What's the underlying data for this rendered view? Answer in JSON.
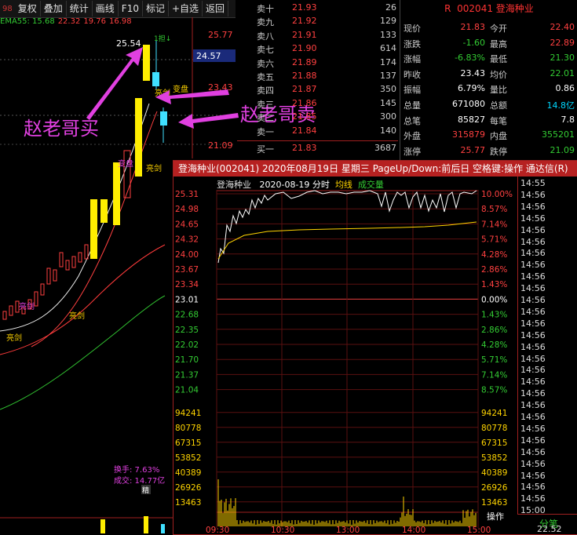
{
  "toolbar": {
    "left_fragment": "98",
    "buttons": [
      "复权",
      "叠加",
      "统计",
      "画线",
      "F10",
      "标记",
      "+自选",
      "返回"
    ]
  },
  "indicator_line": {
    "label": "EMA55: 15.68",
    "values": [
      "22.32",
      "19.76",
      "16.98"
    ]
  },
  "kline": {
    "high_label": "25.54",
    "signal_label": "1担↓",
    "price_axis": [
      "25.77",
      "24.57",
      "23.43",
      "21.09"
    ],
    "markers": [
      "亮剑",
      "变盘",
      "亮剑",
      "变盘",
      "亮剑",
      "亮剑",
      "亮剑"
    ],
    "turnover": "换手: 7.63%",
    "volume_amount": "成交: 14.77亿",
    "bottom_tag": "精"
  },
  "annotations": {
    "buy": "赵老哥买",
    "sell": "赵老哥卖"
  },
  "orderbook": {
    "rows": [
      {
        "label": "卖十",
        "price": "21.93",
        "vol": "26"
      },
      {
        "label": "卖九",
        "price": "21.92",
        "vol": "129"
      },
      {
        "label": "卖八",
        "price": "21.91",
        "vol": "133"
      },
      {
        "label": "卖七",
        "price": "21.90",
        "vol": "614"
      },
      {
        "label": "卖六",
        "price": "21.89",
        "vol": "174"
      },
      {
        "label": "卖五",
        "price": "21.88",
        "vol": "137"
      },
      {
        "label": "卖四",
        "price": "21.87",
        "vol": "350"
      },
      {
        "label": "卖三",
        "price": "21.86",
        "vol": "145"
      },
      {
        "label": "卖二",
        "price": "21.85",
        "vol": "300"
      },
      {
        "label": "卖一",
        "price": "21.84",
        "vol": "140"
      },
      {
        "label": "买一",
        "price": "21.83",
        "vol": "3687"
      }
    ]
  },
  "quote": {
    "title_prefix": "R",
    "code": "002041",
    "name": "登海种业",
    "rows": [
      {
        "l": "现价",
        "lv": "21.83",
        "lc": "red",
        "r": "今开",
        "rv": "22.40",
        "rc": "red"
      },
      {
        "l": "涨跌",
        "lv": "-1.60",
        "lc": "green",
        "r": "最高",
        "rv": "22.89",
        "rc": "red"
      },
      {
        "l": "涨幅",
        "lv": "-6.83%",
        "lc": "green",
        "r": "最低",
        "rv": "21.30",
        "rc": "green"
      },
      {
        "l": "昨收",
        "lv": "23.43",
        "lc": "white",
        "r": "均价",
        "rv": "22.01",
        "rc": "green"
      },
      {
        "l": "振幅",
        "lv": "6.79%",
        "lc": "white",
        "r": "量比",
        "rv": "0.86",
        "rc": "white"
      },
      {
        "l": "总量",
        "lv": "671080",
        "lc": "white",
        "r": "总额",
        "rv": "14.8亿",
        "rc": "cyan"
      },
      {
        "l": "总笔",
        "lv": "85827",
        "lc": "white",
        "r": "每笔",
        "rv": "7.8",
        "rc": "white"
      },
      {
        "l": "外盘",
        "lv": "315879",
        "lc": "red",
        "r": "内盘",
        "rv": "355201",
        "rc": "green"
      },
      {
        "l": "涨停",
        "lv": "25.77",
        "lc": "red",
        "r": "跌停",
        "rv": "21.09",
        "rc": "green"
      }
    ]
  },
  "popup": {
    "title": "登海种业(002041) 2020年08月19日 星期三 PageUp/Down:前后日 空格键:操作 通达信(R)",
    "chart_header": {
      "name": "登海种业",
      "date": "2020-08-19 分时",
      "avg_label": "均线",
      "vol_label": "成交量"
    },
    "left_axis": [
      "25.31",
      "24.98",
      "24.65",
      "24.32",
      "24.00",
      "23.67",
      "23.34",
      "23.01",
      "22.68",
      "22.35",
      "22.02",
      "21.70",
      "21.37",
      "21.04"
    ],
    "right_axis": [
      "10.00%",
      "8.57%",
      "7.14%",
      "5.71%",
      "4.28%",
      "2.86%",
      "1.43%",
      "0.00%",
      "1.43%",
      "2.86%",
      "4.28%",
      "5.71%",
      "7.14%",
      "8.57%"
    ],
    "vol_axis": [
      "94241",
      "80778",
      "67315",
      "53852",
      "40389",
      "26926",
      "13463"
    ],
    "time_axis": [
      "09:30",
      "10:30",
      "13:00",
      "14:00",
      "15:00"
    ],
    "timeline": [
      "14:55",
      "14:56",
      "14:56",
      "14:56",
      "14:56",
      "14:56",
      "14:56",
      "14:56",
      "14:56",
      "14:56",
      "14:56",
      "14:56",
      "14:56",
      "14:56",
      "14:56",
      "14:56",
      "14:56",
      "14:56",
      "14:56",
      "14:56",
      "14:56",
      "14:56",
      "14:56",
      "14:56",
      "14:56",
      "14:56",
      "14:56",
      "14:56",
      "15:00"
    ],
    "operate_label": "操作",
    "tab_label": "分笔",
    "bottom_value": "22.52"
  },
  "colors": {
    "up": "#ff4040",
    "down": "#33cc33",
    "popup_title": "#b62121",
    "annotation": "#e040e0",
    "candle_up_yellow": "#ffee00",
    "candle_down_cyan": "#40e0ff"
  }
}
